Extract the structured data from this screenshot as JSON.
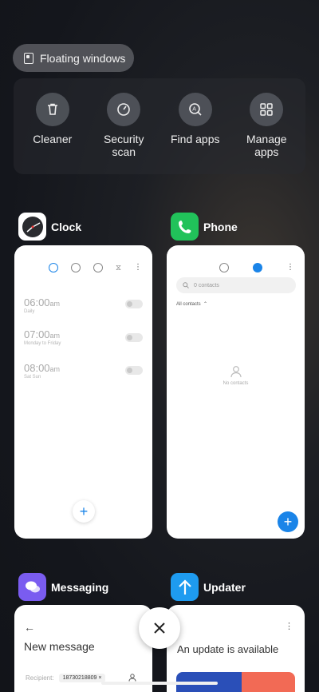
{
  "floating_windows": {
    "label": "Floating windows",
    "icon": "floating-window-icon"
  },
  "actions": [
    {
      "label": "Cleaner",
      "icon": "trash-icon"
    },
    {
      "label": "Security\nscan",
      "icon": "gauge-icon"
    },
    {
      "label": "Find apps",
      "icon": "find-apps-icon"
    },
    {
      "label": "Manage\napps",
      "icon": "grid-icon"
    }
  ],
  "apps": {
    "clock": {
      "name": "Clock",
      "alarms": [
        {
          "time": "06:00",
          "ampm": "am",
          "repeat": "Daily"
        },
        {
          "time": "07:00",
          "ampm": "am",
          "repeat": "Monday to Friday"
        },
        {
          "time": "08:00",
          "ampm": "am",
          "repeat": "Sat Sun"
        }
      ]
    },
    "phone": {
      "name": "Phone",
      "search_placeholder": "0 contacts",
      "filter": "All contacts",
      "empty": "No contacts"
    },
    "messaging": {
      "name": "Messaging",
      "title": "New message",
      "recipient_label": "Recipient:",
      "recipient_value": "18730218809"
    },
    "updater": {
      "name": "Updater",
      "title": "An update is available"
    }
  },
  "colors": {
    "accent_blue": "#1a84e8",
    "phone_green": "#21c25a",
    "messaging_purple": "#7a5cf0",
    "updater_blue": "#1e9bf0"
  }
}
